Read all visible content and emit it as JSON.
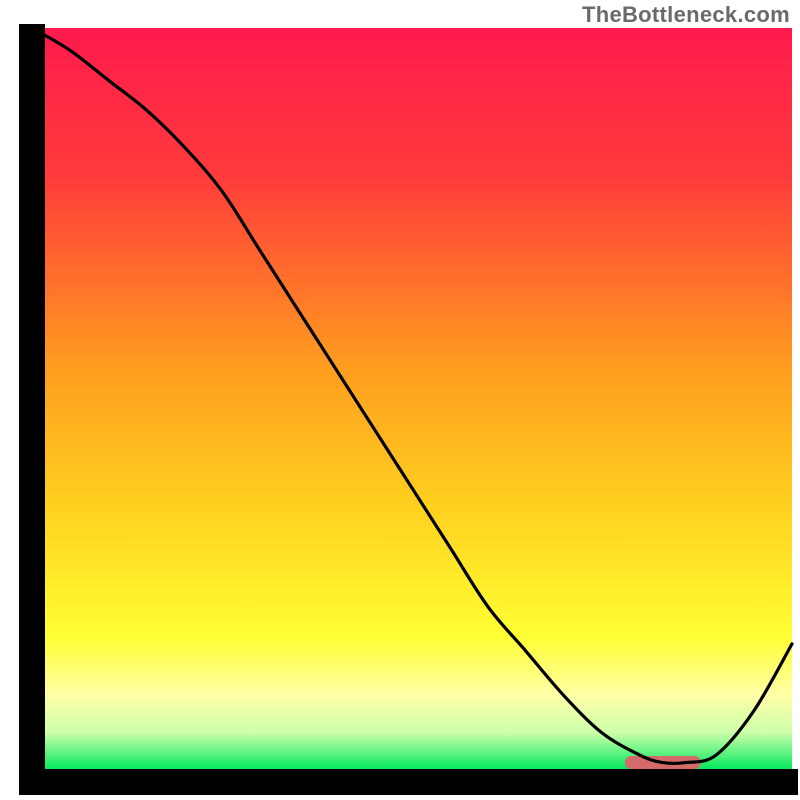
{
  "watermark": "TheBottleneck.com",
  "chart_data": {
    "type": "line",
    "title": "",
    "xlabel": "",
    "ylabel": "",
    "xlim": [
      0,
      100
    ],
    "ylim": [
      0,
      100
    ],
    "grid": false,
    "series": [
      {
        "name": "curve",
        "x": [
          0,
          5,
          10,
          15,
          20,
          25,
          30,
          35,
          40,
          45,
          50,
          55,
          60,
          65,
          70,
          75,
          80,
          83,
          86,
          90,
          95,
          100
        ],
        "y": [
          100,
          97,
          93,
          89,
          84,
          78,
          70,
          62,
          54,
          46,
          38,
          30,
          22,
          16,
          10,
          5,
          2,
          1,
          1,
          2,
          8,
          17
        ]
      }
    ],
    "highlight_band": {
      "x_start": 78,
      "x_end": 88,
      "color": "#d46a6a"
    },
    "background_gradient": {
      "stops": [
        {
          "offset": 0.0,
          "color": "#ff1a4d"
        },
        {
          "offset": 0.2,
          "color": "#ff3b3b"
        },
        {
          "offset": 0.45,
          "color": "#ff9a1f"
        },
        {
          "offset": 0.65,
          "color": "#ffd21f"
        },
        {
          "offset": 0.82,
          "color": "#ffff33"
        },
        {
          "offset": 0.9,
          "color": "#ffffa8"
        },
        {
          "offset": 0.95,
          "color": "#ccffaa"
        },
        {
          "offset": 1.0,
          "color": "#00e85c"
        }
      ]
    },
    "axis_color": "#000000",
    "line_color": "#000000"
  }
}
